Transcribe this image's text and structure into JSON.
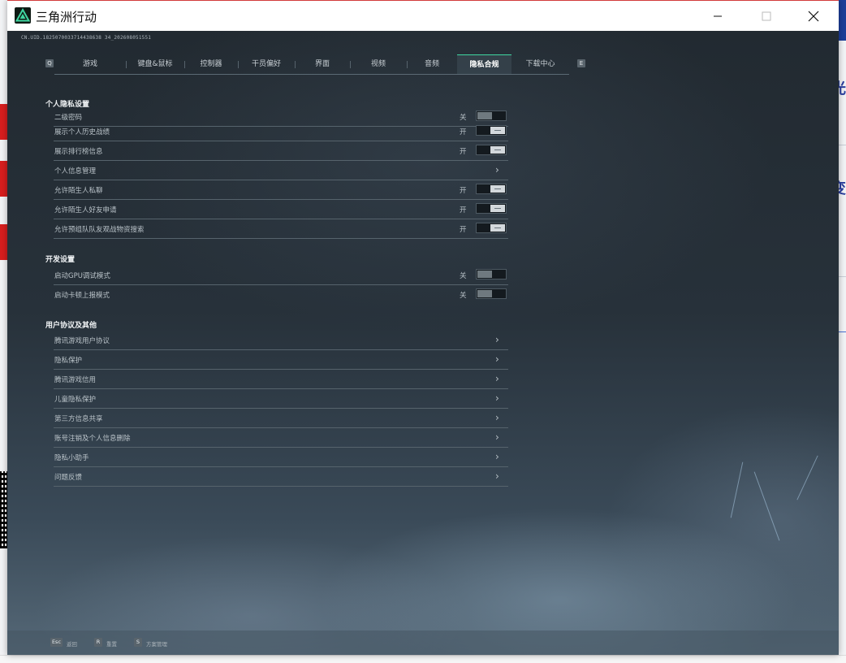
{
  "window": {
    "title": "三角洲行动",
    "uid": "CN.UID.1825070033714438638 34_202608051551"
  },
  "tabs": [
    {
      "label": "游戏"
    },
    {
      "label": "键盘&鼠标"
    },
    {
      "label": "控制器"
    },
    {
      "label": "干员偏好"
    },
    {
      "label": "界面"
    },
    {
      "label": "视频"
    },
    {
      "label": "音频"
    },
    {
      "label": "隐私合规",
      "active": true
    },
    {
      "label": "下载中心"
    }
  ],
  "tab_keys": {
    "prev": "Q",
    "next": "E"
  },
  "privacy": {
    "title": "个人隐私设置",
    "rows": [
      {
        "label": "二级密码",
        "state": "关",
        "type": "toggle",
        "on": false
      },
      {
        "label": "展示个人历史战绩",
        "state": "开",
        "type": "toggle",
        "on": true
      },
      {
        "label": "展示排行榜信息",
        "state": "开",
        "type": "toggle",
        "on": true
      },
      {
        "label": "个人信息管理",
        "type": "link"
      },
      {
        "label": "允许陌生人私聊",
        "state": "开",
        "type": "toggle",
        "on": true
      },
      {
        "label": "允许陌生人好友申请",
        "state": "开",
        "type": "toggle",
        "on": true
      },
      {
        "label": "允许预组队队友观战物资搜索",
        "state": "开",
        "type": "toggle",
        "on": true
      }
    ]
  },
  "dev": {
    "title": "开发设置",
    "rows": [
      {
        "label": "启动GPU调试模式",
        "state": "关",
        "type": "toggle",
        "on": false
      },
      {
        "label": "启动卡顿上报模式",
        "state": "关",
        "type": "toggle",
        "on": false
      }
    ]
  },
  "agreements": {
    "title": "用户协议及其他",
    "rows": [
      {
        "label": "腾讯游戏用户协议",
        "type": "link"
      },
      {
        "label": "隐私保护",
        "type": "link"
      },
      {
        "label": "腾讯游戏信用",
        "type": "link"
      },
      {
        "label": "儿童隐私保护",
        "type": "link"
      },
      {
        "label": "第三方信息共享",
        "type": "link"
      },
      {
        "label": "账号注销及个人信息删除",
        "type": "link"
      },
      {
        "label": "隐私小助手",
        "type": "link"
      },
      {
        "label": "问题反馈",
        "type": "link"
      }
    ]
  },
  "footer": {
    "items": [
      {
        "key": "Esc",
        "label": "返回"
      },
      {
        "key": "R",
        "label": "重置"
      },
      {
        "key": "S",
        "label": "方案管理"
      }
    ]
  },
  "background_page": {
    "side_texts": [
      "光",
      "变"
    ]
  },
  "colors": {
    "accent": "#3fd6a0",
    "panel": "#27313a"
  }
}
